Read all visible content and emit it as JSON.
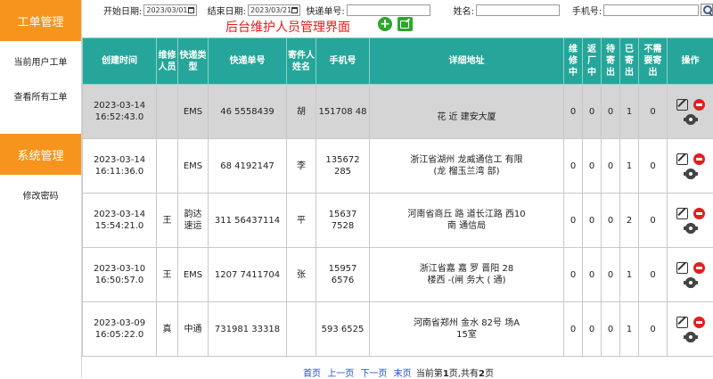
{
  "sidebar": {
    "section1": "工单管理",
    "items1": [
      "当前用户工单",
      "查看所有工单"
    ],
    "section2": "系统管理",
    "items2": [
      "修改密码"
    ]
  },
  "filter": {
    "start_label": "开始日期:",
    "start_value": "2023/03/01",
    "end_label": "结束日期:",
    "end_value": "2023/03/21",
    "tracking_label": "快递单号:",
    "name_label": "姓名:",
    "phone_label": "手机号:"
  },
  "heading": "后台维护人员管理界面",
  "table": {
    "headers": [
      "创建时间",
      "维修人员",
      "快递类型",
      "快递单号",
      "寄件人姓名",
      "手机号",
      "详细地址",
      "维修中",
      "返厂中",
      "待寄出",
      "已寄出",
      "不需要寄出",
      "操作"
    ],
    "rows": [
      {
        "date": "2023-03-14",
        "time": "16:52:43.0",
        "repair": "",
        "type": "EMS",
        "tracking": "46  5558439",
        "sender": "胡",
        "phone": "151708  48",
        "addr1": "",
        "addr2": "花   近 建安大厦",
        "s1": "0",
        "s2": "0",
        "s3": "0",
        "s4": "1",
        "s5": "0"
      },
      {
        "date": "2023-03-14",
        "time": "16:11:36.0",
        "repair": "",
        "type": "EMS",
        "tracking": "68  4192147",
        "sender": "李",
        "phone": "135672  285",
        "addr1": "浙江省湖州   龙威通信工   有限",
        "addr2": "(龙   榴玉兰湾   部)",
        "s1": "0",
        "s2": "0",
        "s3": "0",
        "s4": "1",
        "s5": "0"
      },
      {
        "date": "2023-03-14",
        "time": "15:54:21.0",
        "repair": "王",
        "type": "韵达速运",
        "tracking": "311  56437114",
        "sender": "平",
        "phone": "15637  7528",
        "addr1": "河南省商丘   路   道长江路   西10",
        "addr2": "南   通信局",
        "s1": "0",
        "s2": "0",
        "s3": "0",
        "s4": "2",
        "s5": "0"
      },
      {
        "date": "2023-03-10",
        "time": "16:50:57.0",
        "repair": "王",
        "type": "EMS",
        "tracking": "1207  7411704",
        "sender": "张",
        "phone": "15957  6576",
        "addr1": "浙江省嘉   嘉   罗   晋阳   28",
        "addr2": "楼西   -(闸   务大   (   通)",
        "s1": "0",
        "s2": "0",
        "s3": "0",
        "s4": "1",
        "s5": "0"
      },
      {
        "date": "2023-03-09",
        "time": "16:05:22.0",
        "repair": "真",
        "type": "中通",
        "tracking": "731981  33318",
        "sender": "",
        "phone": "593  6525",
        "addr1": "河南省郑州   金水   82号   场A",
        "addr2": "15室",
        "s1": "0",
        "s2": "0",
        "s3": "0",
        "s4": "1",
        "s5": "0"
      }
    ]
  },
  "pager": {
    "first": "首页",
    "prev": "上一页",
    "next": "下一页",
    "last": "末页",
    "current_prefix": "当前第",
    "current": "1",
    "mid": "页,共有",
    "total": "2",
    "suffix": "页"
  }
}
